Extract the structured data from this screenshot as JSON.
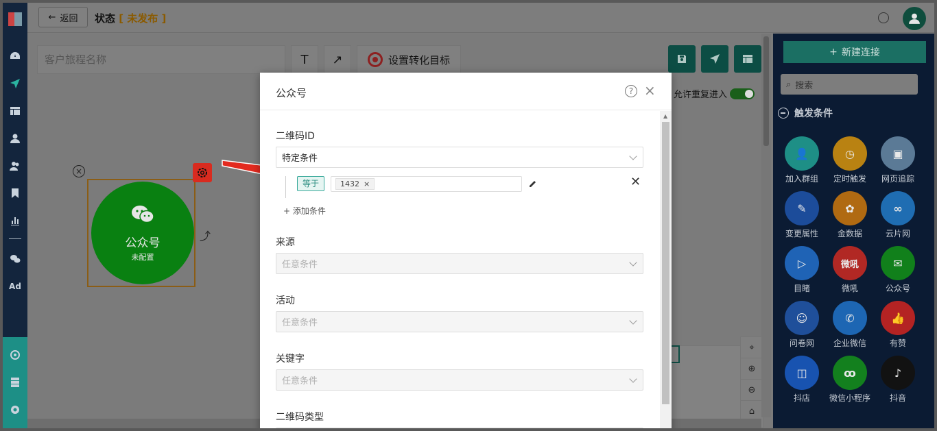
{
  "topbar": {
    "back_label": "返回",
    "status_label": "状态",
    "status_tag": "[ 未发布 ]"
  },
  "toolbar": {
    "name_placeholder": "客户旅程名称",
    "text_tool": "T",
    "arrow_tool": "↗",
    "goal_label": "设置转化目标",
    "allow_reentry_label": "允许重复进入",
    "allow_reentry_on": true
  },
  "node": {
    "title": "公众号",
    "subtitle": "未配置"
  },
  "modal": {
    "title": "公众号",
    "fields": [
      {
        "label": "二维码ID",
        "value": "特定条件",
        "enabled": true
      },
      {
        "label": "来源",
        "value": "任意条件",
        "enabled": false
      },
      {
        "label": "活动",
        "value": "任意条件",
        "enabled": false
      },
      {
        "label": "关键字",
        "value": "任意条件",
        "enabled": false
      },
      {
        "label": "二维码类型",
        "value": "",
        "enabled": false
      }
    ],
    "condition": {
      "operator": "等于",
      "values": [
        "1432"
      ]
    },
    "add_condition_label": "+ 添加条件"
  },
  "right_panel": {
    "new_link_label": "新建连接",
    "search_placeholder": "搜索",
    "section_title": "触发条件",
    "triggers": [
      {
        "label": "加入群组",
        "color": "#1e8f86",
        "icon": "user-plus-icon",
        "glyph": "👤"
      },
      {
        "label": "定时触发",
        "color": "#b98212",
        "icon": "clock-icon",
        "glyph": "◷"
      },
      {
        "label": "网页追踪",
        "color": "#5b7a96",
        "icon": "web-icon",
        "glyph": "▣"
      },
      {
        "label": "变更属性",
        "color": "#1c4c9a",
        "icon": "edit-icon",
        "glyph": "✎"
      },
      {
        "label": "金数据",
        "color": "#b06a12",
        "icon": "jinshuju-icon",
        "glyph": "✿"
      },
      {
        "label": "云片网",
        "color": "#1f6db2",
        "icon": "yunpian-icon",
        "glyph": "∞"
      },
      {
        "label": "目睹",
        "color": "#1f63b5",
        "icon": "play-icon",
        "glyph": "▷"
      },
      {
        "label": "微吼",
        "color": "#b12824",
        "icon": "weihou-icon",
        "glyph": "微吼"
      },
      {
        "label": "公众号",
        "color": "#11801b",
        "icon": "wechat-icon",
        "glyph": "✉"
      },
      {
        "label": "问卷网",
        "color": "#1f4f9a",
        "icon": "survey-icon",
        "glyph": "☺"
      },
      {
        "label": "企业微信",
        "color": "#1d66b3",
        "icon": "wecom-icon",
        "glyph": "✆"
      },
      {
        "label": "有赞",
        "color": "#b42323",
        "icon": "thumb-up-icon",
        "glyph": "👍"
      },
      {
        "label": "抖店",
        "color": "#1853b0",
        "icon": "doudian-icon",
        "glyph": "◫"
      },
      {
        "label": "微信小程序",
        "color": "#13801e",
        "icon": "miniprogram-icon",
        "glyph": "ꝏ"
      },
      {
        "label": "抖音",
        "color": "#121212",
        "icon": "douyin-icon",
        "glyph": "♪"
      }
    ]
  }
}
